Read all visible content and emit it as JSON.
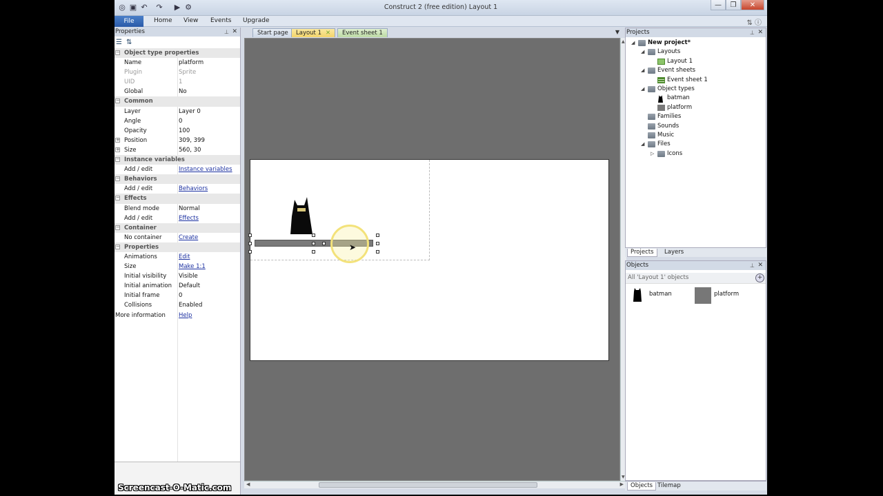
{
  "window": {
    "title": "Construct 2  (free edition)   Layout 1",
    "minimize": "—",
    "maximize": "❐",
    "close": "✕"
  },
  "menu": {
    "file": "File",
    "items": [
      "Home",
      "View",
      "Events",
      "Upgrade"
    ]
  },
  "properties_panel": {
    "title": "Properties",
    "rows": [
      {
        "type": "cat",
        "label": "Object type properties"
      },
      {
        "type": "prop",
        "name": "Name",
        "value": "platform"
      },
      {
        "type": "prop",
        "name": "Plugin",
        "value": "Sprite",
        "disabled": true
      },
      {
        "type": "prop",
        "name": "UID",
        "value": "1",
        "disabled": true
      },
      {
        "type": "prop",
        "name": "Global",
        "value": "No"
      },
      {
        "type": "cat",
        "label": "Common"
      },
      {
        "type": "prop",
        "name": "Layer",
        "value": "Layer 0"
      },
      {
        "type": "prop",
        "name": "Angle",
        "value": "0"
      },
      {
        "type": "prop",
        "name": "Opacity",
        "value": "100"
      },
      {
        "type": "prop",
        "name": "Position",
        "value": "309, 399",
        "expandable": true
      },
      {
        "type": "prop",
        "name": "Size",
        "value": "560, 30",
        "expandable": true
      },
      {
        "type": "cat",
        "label": "Instance variables"
      },
      {
        "type": "prop",
        "name": "Add / edit",
        "value": "Instance variables",
        "link": true
      },
      {
        "type": "cat",
        "label": "Behaviors"
      },
      {
        "type": "prop",
        "name": "Add / edit",
        "value": "Behaviors",
        "link": true
      },
      {
        "type": "cat",
        "label": "Effects"
      },
      {
        "type": "prop",
        "name": "Blend mode",
        "value": "Normal"
      },
      {
        "type": "prop",
        "name": "Add / edit",
        "value": "Effects",
        "link": true
      },
      {
        "type": "cat",
        "label": "Container"
      },
      {
        "type": "prop",
        "name": "No container",
        "value": "Create",
        "link": true
      },
      {
        "type": "cat",
        "label": "Properties"
      },
      {
        "type": "prop",
        "name": "Animations",
        "value": "Edit",
        "link": true
      },
      {
        "type": "prop",
        "name": "Size",
        "value": "Make 1:1",
        "link": true
      },
      {
        "type": "prop",
        "name": "Initial visibility",
        "value": "Visible"
      },
      {
        "type": "prop",
        "name": "Initial animation",
        "value": "Default"
      },
      {
        "type": "prop",
        "name": "Initial frame",
        "value": "0"
      },
      {
        "type": "prop",
        "name": "Collisions",
        "value": "Enabled"
      },
      {
        "type": "prop",
        "name": "More information",
        "value": "Help",
        "link": true,
        "nopad": true
      }
    ]
  },
  "tabs": [
    {
      "label": "Start page"
    },
    {
      "label": "Layout 1",
      "active": true
    },
    {
      "label": "Event sheet 1"
    }
  ],
  "projects_panel": {
    "title": "Projects",
    "tree": [
      {
        "label": "New project*",
        "depth": 0,
        "icon": "folder",
        "expanded": true,
        "bold": true
      },
      {
        "label": "Layouts",
        "depth": 1,
        "icon": "folder",
        "expanded": true
      },
      {
        "label": "Layout 1",
        "depth": 2,
        "icon": "layout"
      },
      {
        "label": "Event sheets",
        "depth": 1,
        "icon": "folder",
        "expanded": true
      },
      {
        "label": "Event sheet 1",
        "depth": 2,
        "icon": "sheet"
      },
      {
        "label": "Object types",
        "depth": 1,
        "icon": "folder",
        "expanded": true
      },
      {
        "label": "batman",
        "depth": 2,
        "icon": "batman"
      },
      {
        "label": "platform",
        "depth": 2,
        "icon": "gray"
      },
      {
        "label": "Families",
        "depth": 1,
        "icon": "folder"
      },
      {
        "label": "Sounds",
        "depth": 1,
        "icon": "folder"
      },
      {
        "label": "Music",
        "depth": 1,
        "icon": "folder"
      },
      {
        "label": "Files",
        "depth": 1,
        "icon": "folder",
        "expanded": true
      },
      {
        "label": "Icons",
        "depth": 2,
        "icon": "folder",
        "collapsed": true
      }
    ],
    "tabs": [
      "Projects",
      "Layers"
    ]
  },
  "objects_panel": {
    "title": "Objects",
    "filter": "All 'Layout 1' objects",
    "items": [
      {
        "label": "batman",
        "icon": "batman"
      },
      {
        "label": "platform",
        "icon": "gray"
      }
    ],
    "tabs": [
      "Objects",
      "Tilemap"
    ]
  },
  "watermark": "Screencast-O-Matic.com",
  "colors": {
    "accent": "#2a5aa8",
    "active_tab": "#f3d46a",
    "canvas_bg": "#6e6e6e"
  }
}
